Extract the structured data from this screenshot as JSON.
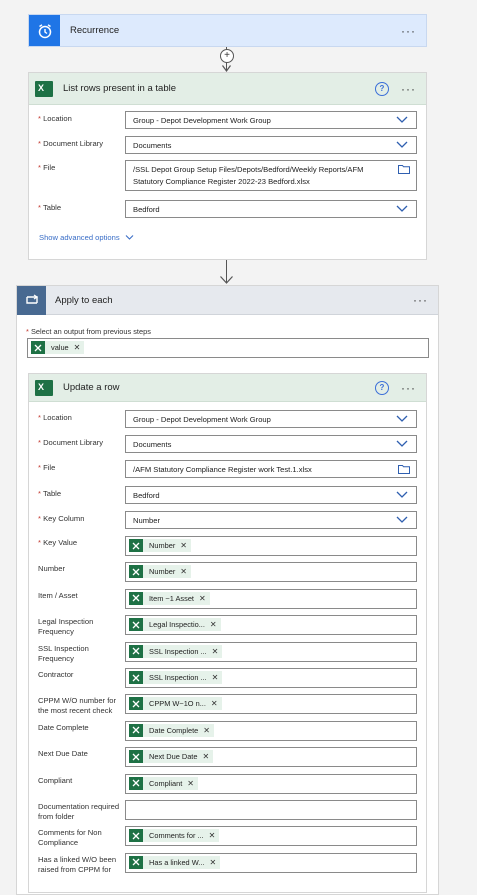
{
  "recurrence": {
    "title": "Recurrence"
  },
  "list_rows": {
    "title": "List rows present in a table",
    "fields": [
      {
        "label": "Location",
        "required": true,
        "value": "Group - Depot Development Work Group"
      },
      {
        "label": "Document Library",
        "required": true,
        "value": "Documents"
      },
      {
        "label": "File",
        "required": true,
        "value": "/SSL Depot Group Setup Files/Depots/Bedford/Weekly Reports/AFM Statutory Compliance Register 2022-23 Bedford.xlsx"
      },
      {
        "label": "Table",
        "required": true,
        "value": "Bedford"
      }
    ],
    "advanced": "Show advanced options"
  },
  "apply_each": {
    "title": "Apply to each",
    "select_label": "Select an output from previous steps",
    "token": "value"
  },
  "update_row": {
    "title": "Update a row",
    "fields": [
      {
        "label": "Location",
        "required": true,
        "value": "Group - Depot Development Work Group"
      },
      {
        "label": "Document Library",
        "required": true,
        "value": "Documents"
      },
      {
        "label": "File",
        "required": true,
        "value": "/AFM Statutory Compliance Register work Test.1.xlsx"
      },
      {
        "label": "Table",
        "required": true,
        "value": "Bedford"
      },
      {
        "label": "Key Column",
        "required": true,
        "value": "Number"
      }
    ],
    "token_fields": [
      {
        "label": "Key Value",
        "required": true,
        "token": "Number"
      },
      {
        "label": "Number",
        "required": false,
        "token": "Number"
      },
      {
        "label": "Item / Asset",
        "required": false,
        "token": "Item ~1 Asset"
      },
      {
        "label": "Legal Inspection Frequency",
        "required": false,
        "token": "Legal Inspectio..."
      },
      {
        "label": "SSL Inspection Frequency",
        "required": false,
        "token": "SSL Inspection ..."
      },
      {
        "label": "Contractor",
        "required": false,
        "token": "SSL Inspection ..."
      },
      {
        "label": "CPPM W/O number for the most recent check",
        "required": false,
        "token": "CPPM W~1O n..."
      },
      {
        "label": "Date Complete",
        "required": false,
        "token": "Date Complete"
      },
      {
        "label": "Next Due Date",
        "required": false,
        "token": "Next Due Date"
      },
      {
        "label": "Compliant",
        "required": false,
        "token": "Compliant"
      },
      {
        "label": "Documentation required from folder",
        "required": false,
        "token": ""
      },
      {
        "label": "Comments for Non Compliance",
        "required": false,
        "token": "Comments for ..."
      },
      {
        "label": "Has a linked W/O been raised from CPPM for",
        "required": false,
        "token": "Has a linked W..."
      }
    ]
  },
  "colors": {
    "accent": "#0f6cbd",
    "excel": "#1e7145",
    "apply": "#486991",
    "required": "#c2362c"
  }
}
